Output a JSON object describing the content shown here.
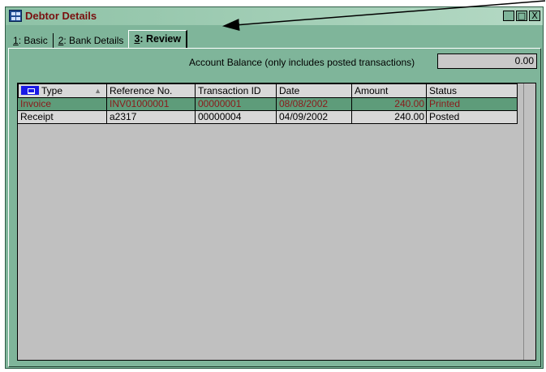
{
  "window": {
    "title": "Debtor Details",
    "controls": {
      "minimize": "_",
      "maximize": "□",
      "close": "X"
    }
  },
  "tabs": [
    {
      "key": "1",
      "label": ": Basic"
    },
    {
      "key": "2",
      "label": ": Bank Details"
    },
    {
      "key": "3",
      "label": ": Review"
    }
  ],
  "balance": {
    "label": "Account Balance (only includes posted transactions)",
    "value": "0.00"
  },
  "grid": {
    "columns": [
      "Type",
      "Reference No.",
      "Transaction ID",
      "Date",
      "Amount",
      "Status"
    ],
    "rows": [
      [
        "Invoice",
        "INV01000001",
        "00000001",
        "08/08/2002",
        "240.00",
        "Printed"
      ],
      [
        "Receipt",
        "a2317",
        "00000004",
        "04/09/2002",
        "240.00",
        "Posted"
      ]
    ]
  },
  "colors": {
    "window_bg": "#7fb59a",
    "title_text": "#7a0f0f",
    "selected_row": "#5e9c7a",
    "grid_bg": "#c0c0c0"
  }
}
